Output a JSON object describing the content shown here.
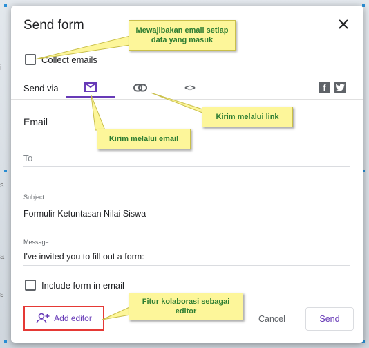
{
  "dialog": {
    "title": "Send form"
  },
  "collect_emails": {
    "label": "Collect emails",
    "checked": false
  },
  "send_via": {
    "label": "Send via",
    "tabs": [
      {
        "icon": "envelope-icon",
        "active": true
      },
      {
        "icon": "link-icon",
        "active": false
      },
      {
        "icon": "embed-code-icon",
        "text": "<>",
        "active": false
      }
    ],
    "social": [
      {
        "icon": "facebook-icon",
        "text": "f"
      },
      {
        "icon": "twitter-icon"
      }
    ]
  },
  "email_section": {
    "title": "Email",
    "to": {
      "placeholder": "To"
    },
    "subject": {
      "label": "Subject",
      "value": "Formulir Ketuntasan Nilai Siswa"
    },
    "message": {
      "label": "Message",
      "value": "I've invited you to fill out a form:"
    },
    "include_form": {
      "label": "Include form in email",
      "checked": false
    }
  },
  "footer": {
    "add_editor_label": "Add editor",
    "cancel_label": "Cancel",
    "send_label": "Send"
  },
  "callouts": {
    "collect": "Mewajibakan email setiap data yang masuk",
    "link": "Kirim melalui link",
    "email": "Kirim melalui email",
    "editor": "Fitur kolaborasi sebagai editor"
  },
  "colors": {
    "accent": "#673ab7",
    "callout_bg": "#fdf69a",
    "callout_text": "#2e7d32",
    "highlight_border": "#e53935"
  }
}
